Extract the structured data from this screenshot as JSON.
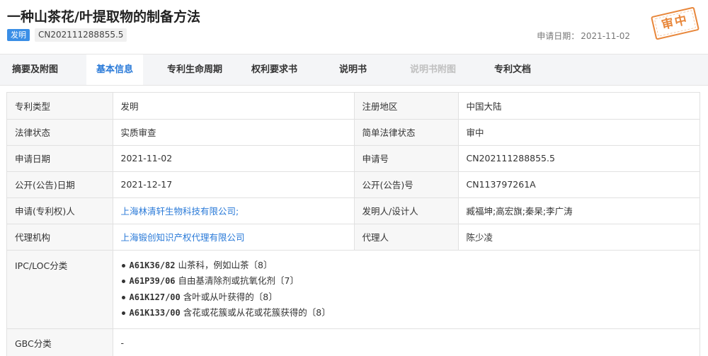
{
  "header": {
    "title": "一种山茶花/叶提取物的制备方法",
    "type_badge": "发明",
    "pub_no": "CN202111288855.5",
    "apply_date_label": "申请日期：",
    "apply_date_value": "2021-11-02",
    "stamp_text": "审中",
    "stamp_color": "#e8873b"
  },
  "tabs": [
    {
      "label": "摘要及附图",
      "state": "normal"
    },
    {
      "label": "基本信息",
      "state": "active"
    },
    {
      "label": "专利生命周期",
      "state": "normal"
    },
    {
      "label": "权利要求书",
      "state": "normal"
    },
    {
      "label": "说明书",
      "state": "normal"
    },
    {
      "label": "说明书附图",
      "state": "disabled"
    },
    {
      "label": "专利文档",
      "state": "normal"
    }
  ],
  "info": {
    "rows": [
      {
        "l1": "专利类型",
        "v1": "发明",
        "l2": "注册地区",
        "v2": "中国大陆"
      },
      {
        "l1": "法律状态",
        "v1": "实质审查",
        "l2": "简单法律状态",
        "v2": "审中"
      },
      {
        "l1": "申请日期",
        "v1": "2021-11-02",
        "l2": "申请号",
        "v2": "CN202111288855.5"
      },
      {
        "l1": "公开(公告)日期",
        "v1": "2021-12-17",
        "l2": "公开(公告)号",
        "v2": "CN113797261A"
      },
      {
        "l1": "申请(专利权)人",
        "v1": "上海林清轩生物科技有限公司;",
        "l2": "发明人/设计人",
        "v2": "臧福坤;高宏旗;秦杲;李广涛"
      },
      {
        "l1": "代理机构",
        "v1": "上海锻创知识产权代理有限公司",
        "l2": "代理人",
        "v2": "陈少凌"
      }
    ],
    "ipc_label": "IPC/LOC分类",
    "ipc_items": [
      {
        "code": "A61K36/82",
        "desc": "山茶科，例如山茶〔8〕"
      },
      {
        "code": "A61P39/06",
        "desc": "自由基清除剂或抗氧化剂〔7〕"
      },
      {
        "code": "A61K127/00",
        "desc": "含叶或从叶获得的〔8〕"
      },
      {
        "code": "A61K133/00",
        "desc": "含花或花簇或从花或花簇获得的〔8〕"
      }
    ],
    "gbc_label": "GBC分类",
    "gbc_value": "-"
  }
}
